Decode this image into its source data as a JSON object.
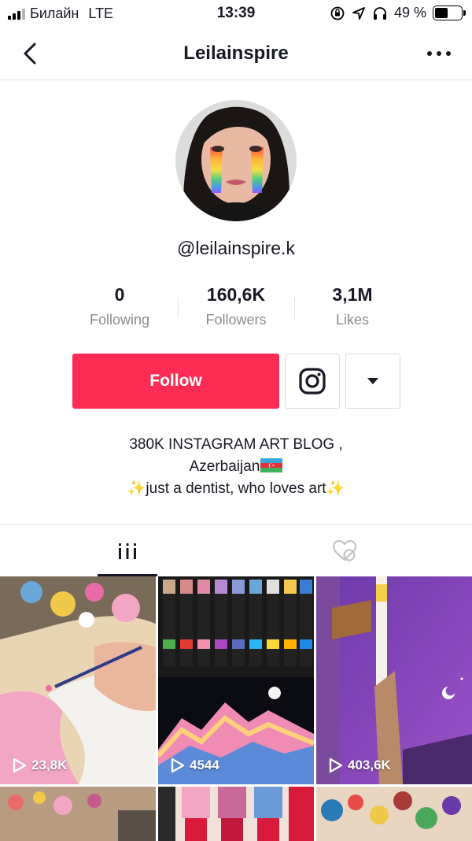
{
  "status_bar": {
    "carrier": "Билайн",
    "network": "LTE",
    "time": "13:39",
    "battery": "49 %",
    "battery_level": 0.49
  },
  "nav": {
    "title": "Leilainspire",
    "back_icon": "chevron-left-icon",
    "more_icon": "more-horizontal-icon"
  },
  "profile": {
    "handle": "@leilainspire.k",
    "stats": [
      {
        "value": "0",
        "label": "Following"
      },
      {
        "value": "160,6K",
        "label": "Followers"
      },
      {
        "value": "3,1M",
        "label": "Likes"
      }
    ],
    "follow_label": "Follow",
    "bio_line1": "380K INSTAGRAM ART BLOG ,",
    "bio_line2": "Azerbaijan",
    "bio_line3": "✨just a dentist, who loves art✨"
  },
  "tabs": [
    {
      "icon": "grid-icon",
      "active": true
    },
    {
      "icon": "liked-hidden-icon",
      "active": false
    }
  ],
  "videos": [
    {
      "views": "23,8K"
    },
    {
      "views": "4544"
    },
    {
      "views": "403,6K"
    },
    {
      "views": ""
    },
    {
      "views": ""
    },
    {
      "views": ""
    }
  ],
  "colors": {
    "accent": "#fe2c55",
    "text": "#161823",
    "muted": "#8a8b91",
    "divider": "#e3e3e4"
  }
}
